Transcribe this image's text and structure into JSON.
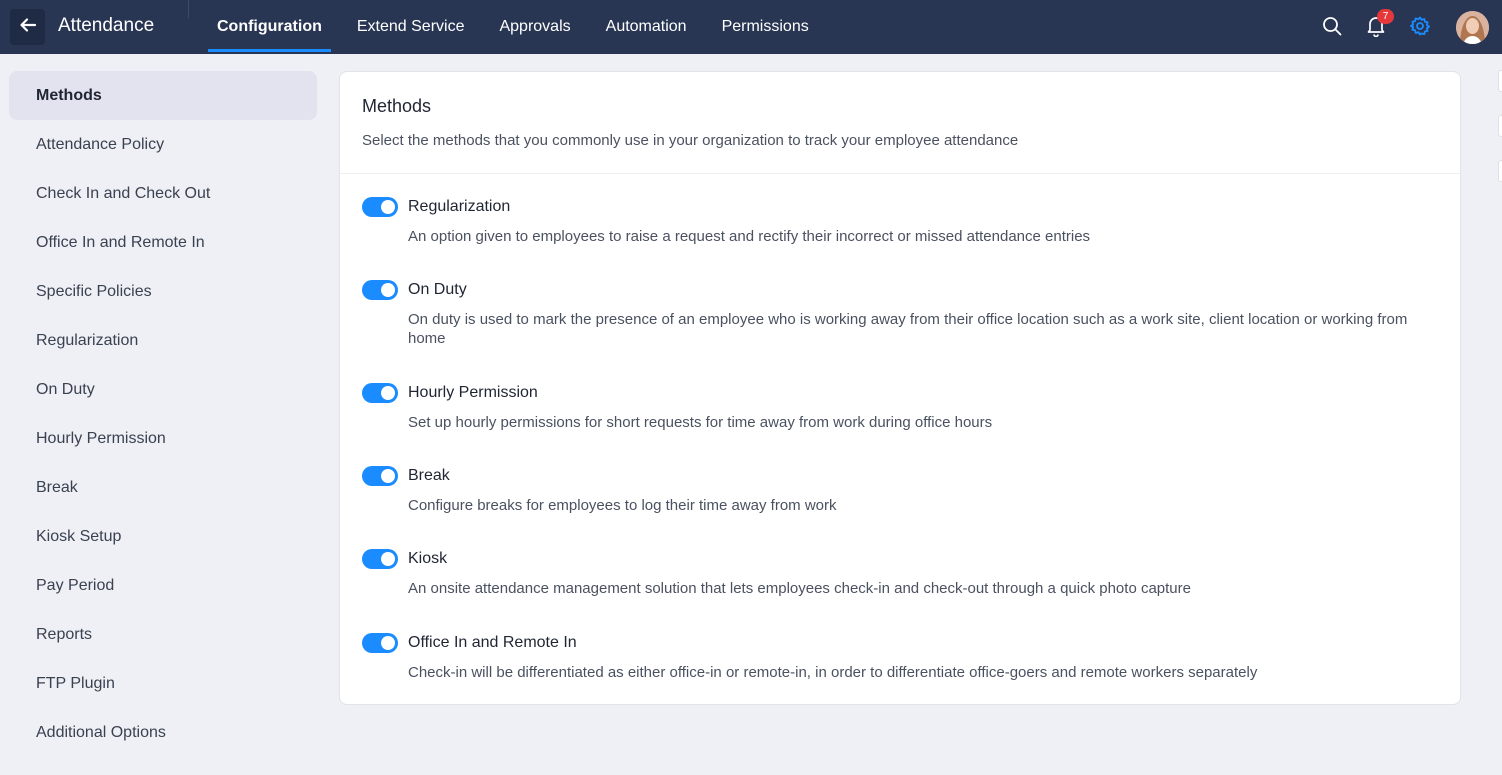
{
  "header": {
    "title": "Attendance",
    "tabs": [
      {
        "label": "Configuration",
        "active": true
      },
      {
        "label": "Extend Service",
        "active": false
      },
      {
        "label": "Approvals",
        "active": false
      },
      {
        "label": "Automation",
        "active": false
      },
      {
        "label": "Permissions",
        "active": false
      }
    ],
    "notification_count": "7",
    "icons": [
      "back-arrow-icon",
      "search-icon",
      "bell-icon",
      "gear-icon",
      "avatar"
    ]
  },
  "sidebar": {
    "items": [
      {
        "label": "Methods",
        "active": true
      },
      {
        "label": "Attendance Policy"
      },
      {
        "label": "Check In and Check Out"
      },
      {
        "label": "Office In and Remote In"
      },
      {
        "label": "Specific Policies"
      },
      {
        "label": "Regularization"
      },
      {
        "label": "On Duty"
      },
      {
        "label": "Hourly Permission"
      },
      {
        "label": "Break"
      },
      {
        "label": "Kiosk Setup"
      },
      {
        "label": "Pay Period"
      },
      {
        "label": "Reports"
      },
      {
        "label": "FTP Plugin"
      },
      {
        "label": "Additional Options"
      }
    ]
  },
  "main": {
    "title": "Methods",
    "description": "Select the methods that you commonly use in your organization to track your employee attendance",
    "methods": [
      {
        "name": "Regularization",
        "enabled": true,
        "description": "An option given to employees to raise a request and rectify their incorrect or missed attendance entries"
      },
      {
        "name": "On Duty",
        "enabled": true,
        "description": "On duty is used to mark the presence of an employee who is working away from their office location such as a work site, client location or working from home"
      },
      {
        "name": "Hourly Permission",
        "enabled": true,
        "description": "Set up hourly permissions for short requests for time away from work during office hours"
      },
      {
        "name": "Break",
        "enabled": true,
        "description": "Configure breaks for employees to log their time away from work"
      },
      {
        "name": "Kiosk",
        "enabled": true,
        "description": "An onsite attendance management solution that lets employees check-in and check-out through a quick photo capture"
      },
      {
        "name": "Office In and Remote In",
        "enabled": true,
        "description": "Check-in will be differentiated as either office-in or remote-in, in order to differentiate office-goers and remote workers separately"
      }
    ]
  },
  "colors": {
    "topbar": "#283654",
    "accent": "#1a8cff",
    "badge": "#e5383b",
    "background": "#eef0f5"
  }
}
